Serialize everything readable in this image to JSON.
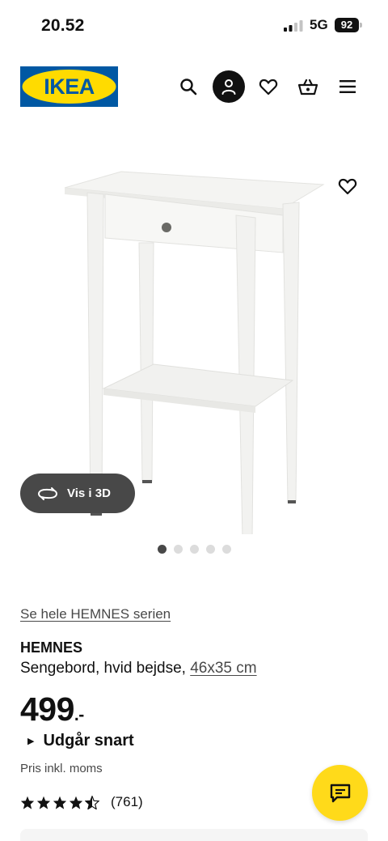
{
  "status_bar": {
    "time": "20.52",
    "network": "5G",
    "battery": "92"
  },
  "header": {
    "logo_text": "IKEA",
    "logo_colors": {
      "background": "#0058a3",
      "oval": "#ffdb00",
      "text": "#0058a3"
    },
    "icons": [
      "search-icon",
      "profile-icon",
      "heart-icon",
      "basket-icon",
      "menu-icon"
    ]
  },
  "gallery": {
    "view_3d_label": "Vis i 3D",
    "dots_count": 5,
    "active_dot": 1
  },
  "product": {
    "series_link": "Se hele HEMNES serien",
    "name": "HEMNES",
    "description": "Sengebord, hvid bejdse,",
    "measurement": "46x35 cm",
    "price": "499",
    "price_suffix": ".-",
    "availability": "Udgår snart",
    "tax_note": "Pris inkl. moms",
    "rating": 4.5,
    "review_count": "(761)"
  },
  "colors": {
    "accent_yellow": "#ffda1a",
    "dark": "#111111",
    "grey_text": "#484848"
  }
}
